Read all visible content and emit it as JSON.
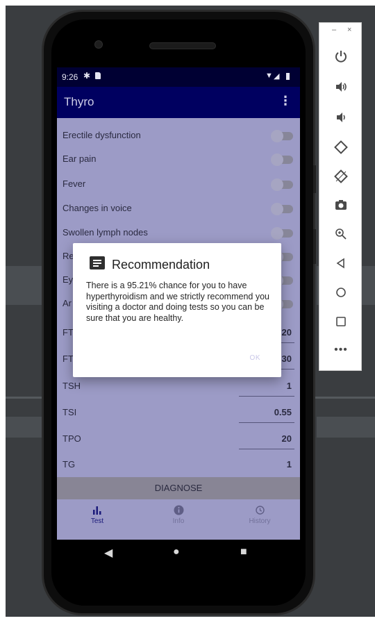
{
  "status_bar": {
    "time": "9:26",
    "icons": [
      "gear-icon",
      "sd-card-icon",
      "wifi-icon",
      "signal-icon",
      "battery-icon"
    ]
  },
  "app_bar": {
    "title": "Thyro",
    "menu_icon": "more-vert-icon"
  },
  "symptoms": [
    {
      "label": "Erectile dysfunction",
      "checked": false
    },
    {
      "label": "Ear pain",
      "checked": false
    },
    {
      "label": "Fever",
      "checked": false
    },
    {
      "label": "Changes in voice",
      "checked": false
    },
    {
      "label": "Swollen lymph nodes",
      "checked": false
    },
    {
      "label": "Re",
      "checked": false
    },
    {
      "label": "Ey",
      "checked": false
    },
    {
      "label": "Ar",
      "checked": false
    }
  ],
  "lab_values": [
    {
      "label": "FT",
      "value": "20"
    },
    {
      "label": "FT",
      "value": "30"
    },
    {
      "label": "TSH",
      "value": "1"
    },
    {
      "label": "TSI",
      "value": "0.55"
    },
    {
      "label": "TPO",
      "value": "20"
    },
    {
      "label": "TG",
      "value": "1"
    }
  ],
  "diagnose_label": "DIAGNOSE",
  "bottom_nav": [
    {
      "label": "Test",
      "icon": "bar-chart-icon",
      "active": true
    },
    {
      "label": "Info",
      "icon": "info-icon",
      "active": false
    },
    {
      "label": "History",
      "icon": "history-icon",
      "active": false
    }
  ],
  "dialog": {
    "icon": "comment-icon",
    "title": "Recommendation",
    "message": "There is a 95.21% chance for you to have hyperthyroidism and we strictly recommend you visiting a doctor and doing tests so you can be sure that you are healthy.",
    "ok_label": "OK"
  },
  "emulator_toolbar": {
    "minimize": "–",
    "close": "×",
    "buttons": [
      "power-icon",
      "volume-up-icon",
      "volume-down-icon",
      "rotate-left-icon",
      "rotate-right-icon",
      "camera-icon",
      "zoom-icon",
      "back-icon",
      "home-icon",
      "overview-icon",
      "more-icon"
    ]
  },
  "colors": {
    "app_bar": "#000060",
    "status_bar": "#000033",
    "scrim_background": "#9c9bc6",
    "dialog": "#ffffff"
  }
}
